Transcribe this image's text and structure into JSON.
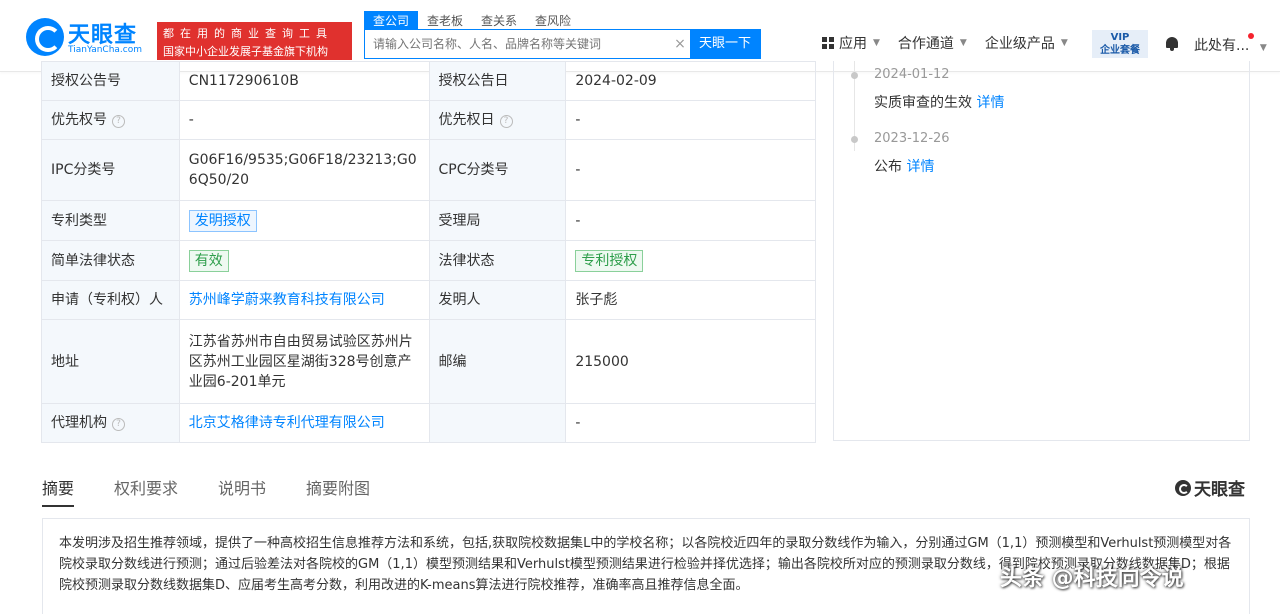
{
  "header": {
    "logo_name": "天眼查",
    "logo_sub": "TianYanCha.com",
    "slogan_line1": "都在用的商业查询工具",
    "slogan_line2": "国家中小企业发展子基金旗下机构",
    "search_tabs": [
      "查公司",
      "查老板",
      "查关系",
      "查风险"
    ],
    "search_placeholder": "请输入公司名称、人名、品牌名称等关键词",
    "search_button": "天眼一下",
    "nav": [
      "应用",
      "合作通道",
      "企业级产品"
    ],
    "vip_line1": "VIP",
    "vip_line2": "企业套餐",
    "user": "此处有..."
  },
  "info": {
    "rows": [
      {
        "l1": "授权公告号",
        "v1": "CN117290610B",
        "l2": "授权公告日",
        "v2": "2024-02-09"
      },
      {
        "l1": "优先权号",
        "v1": "-",
        "l2": "优先权日",
        "v2": "-"
      },
      {
        "l1": "IPC分类号",
        "v1": "G06F16/9535;G06F18/23213;G06Q50/20",
        "l2": "CPC分类号",
        "v2": "-"
      },
      {
        "l1": "专利类型",
        "v1": "发明授权",
        "l2": "受理局",
        "v2": "-"
      },
      {
        "l1": "简单法律状态",
        "v1": "有效",
        "l2": "法律状态",
        "v2": "专利授权"
      },
      {
        "l1": "申请（专利权）人",
        "v1": "苏州峰学蔚来教育科技有限公司",
        "l2": "发明人",
        "v2": "张子彪"
      },
      {
        "l1": "地址",
        "v1": "江苏省苏州市自由贸易试验区苏州片区苏州工业园区星湖街328号创意产业园6-201单元",
        "l2": "邮编",
        "v2": "215000"
      },
      {
        "l1": "代理机构",
        "v1": "北京艾格律诗专利代理有限公司",
        "l2": "",
        "v2": "-"
      }
    ]
  },
  "timeline": [
    {
      "date": "2024-01-12",
      "text": "实质审查的生效",
      "link": "详情"
    },
    {
      "date": "2023-12-26",
      "text": "公布",
      "link": "详情"
    }
  ],
  "tabs": [
    "摘要",
    "权利要求",
    "说明书",
    "摘要附图"
  ],
  "brand_right": "天眼查",
  "abstract": "本发明涉及招生推荐领域，提供了一种高校招生信息推荐方法和系统，包括,获取院校数据集L中的学校名称；以各院校近四年的录取分数线作为输入，分别通过GM（1,1）预测模型和Verhulst预测模型对各院校录取分数线进行预测；通过后验差法对各院校的GM（1,1）模型预测结果和Verhulst模型预测结果进行检验并择优选择；输出各院校所对应的预测录取分数线，得到院校预测录取分数线数据集D；根据院校预测录取分数线数据集D、应届考生高考分数，利用改进的K-means算法进行院校推荐，准确率高且推荐信息全面。",
  "watermark": "头条 @科技向令说",
  "colors": {
    "accent": "#0084ff",
    "slogan_bg": "#e0312e",
    "label_bg": "#f4f8fc"
  }
}
